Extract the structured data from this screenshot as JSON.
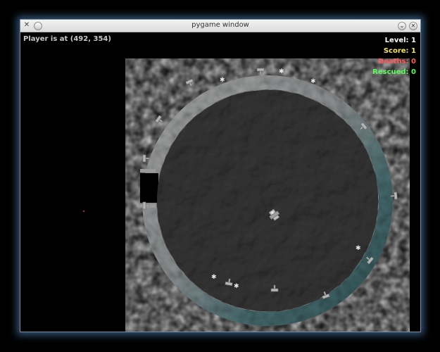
{
  "window": {
    "title": "pygame window"
  },
  "hud": {
    "player_position": "Player is at (492, 354)",
    "level": "Level: 1",
    "score": "Score: 1",
    "deaths": "Deaths: 0",
    "rescued": "Rescued: 0"
  },
  "colors": {
    "level": "#ffffff",
    "score": "#f2e65a",
    "deaths": "#ff5a5a",
    "rescued": "#5aff5a",
    "hud_text": "#c8c8c8"
  },
  "icons": {
    "app": "crossed-tools-icon",
    "minimize": "chevron-down-icon",
    "close": "close-icon"
  }
}
